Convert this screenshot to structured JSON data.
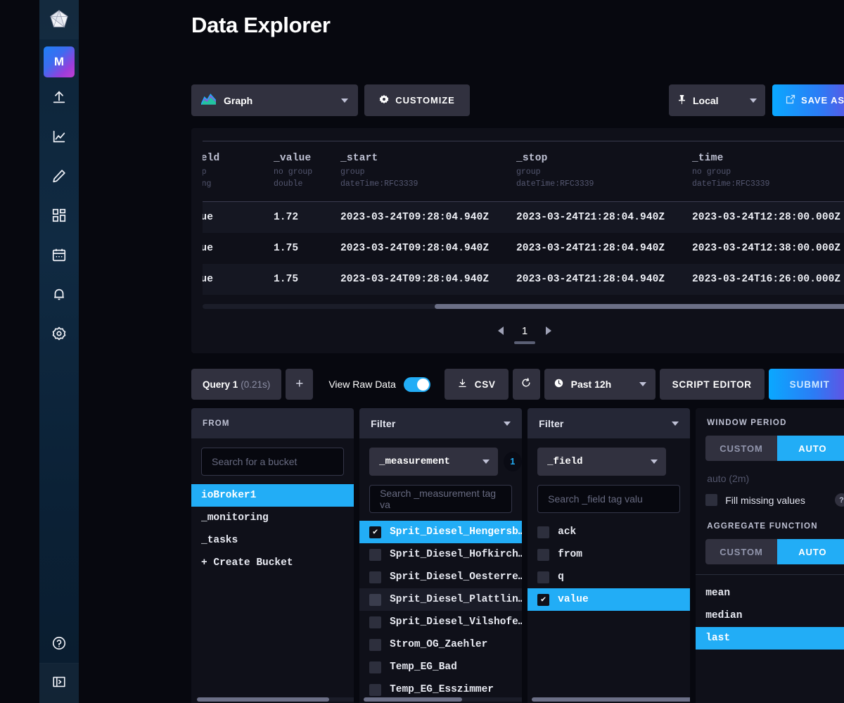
{
  "page": {
    "title": "Data Explorer"
  },
  "nav": {
    "logo": "influxdb-logo",
    "avatar_initial": "M",
    "items": [
      {
        "icon": "upload-icon",
        "name": "load-data"
      },
      {
        "icon": "line-chart-icon",
        "name": "explore"
      },
      {
        "icon": "pencil-icon",
        "name": "notebooks"
      },
      {
        "icon": "dashboard-grid-icon",
        "name": "dashboards"
      },
      {
        "icon": "calendar-icon",
        "name": "tasks"
      },
      {
        "icon": "bell-icon",
        "name": "alerts"
      },
      {
        "icon": "gear-icon",
        "name": "settings"
      }
    ],
    "help_icon": "question-circle-icon",
    "presentation_icon": "panel-expand-icon"
  },
  "toolbar": {
    "viz_type": "Graph",
    "viz_icon": "area-chart-icon",
    "customize_label": "CUSTOMIZE",
    "customize_icon": "gear-icon",
    "local_label": "Local",
    "local_icon": "pin-icon",
    "save_as_label": "SAVE AS",
    "save_as_icon": "external-link-icon"
  },
  "raw_table": {
    "columns": [
      {
        "name": "_field",
        "group": "group",
        "type": "string"
      },
      {
        "name": "_value",
        "group": "no group",
        "type": "double"
      },
      {
        "name": "_start",
        "group": "group",
        "type": "dateTime:RFC3339"
      },
      {
        "name": "_stop",
        "group": "group",
        "type": "dateTime:RFC3339"
      },
      {
        "name": "_time",
        "group": "no group",
        "type": "dateTime:RFC3339"
      }
    ],
    "rows": [
      [
        "value",
        "1.72",
        "2023-03-24T09:28:04.940Z",
        "2023-03-24T21:28:04.940Z",
        "2023-03-24T12:28:00.000Z"
      ],
      [
        "value",
        "1.75",
        "2023-03-24T09:28:04.940Z",
        "2023-03-24T21:28:04.940Z",
        "2023-03-24T12:38:00.000Z"
      ],
      [
        "value",
        "1.75",
        "2023-03-24T09:28:04.940Z",
        "2023-03-24T21:28:04.940Z",
        "2023-03-24T16:26:00.000Z"
      ]
    ],
    "pagination": {
      "page": "1",
      "prev_icon": "chevron-left-icon",
      "next_icon": "chevron-right-icon"
    }
  },
  "query_bar": {
    "query_label": "Query 1",
    "query_duration": "(0.21s)",
    "add_query_label": "+",
    "raw_data_label": "View Raw Data",
    "raw_data_on": true,
    "csv_label": "CSV",
    "csv_icon": "download-icon",
    "refresh_icon": "refresh-icon",
    "time_range": "Past 12h",
    "time_icon": "clock-icon",
    "script_editor_label": "SCRIPT EDITOR",
    "submit_label": "SUBMIT"
  },
  "from_panel": {
    "header": "FROM",
    "search_placeholder": "Search for a bucket",
    "buckets": [
      {
        "label": "ioBroker1",
        "selected": true
      },
      {
        "label": "_monitoring",
        "selected": false
      },
      {
        "label": "_tasks",
        "selected": false
      }
    ],
    "create_bucket_label": "+ Create Bucket"
  },
  "filter_measurement": {
    "header": "Filter",
    "tag_key": "_measurement",
    "count": "1",
    "search_placeholder": "Search _measurement tag va",
    "values": [
      {
        "label": "Sprit_Diesel_Hengersb…",
        "checked": true,
        "hover": false
      },
      {
        "label": "Sprit_Diesel_Hofkirch…",
        "checked": false,
        "hover": false
      },
      {
        "label": "Sprit_Diesel_Oesterre…",
        "checked": false,
        "hover": false
      },
      {
        "label": "Sprit_Diesel_Plattlin…",
        "checked": false,
        "hover": true
      },
      {
        "label": "Sprit_Diesel_Vilshofe…",
        "checked": false,
        "hover": false
      },
      {
        "label": "Strom_OG_Zaehler",
        "checked": false,
        "hover": false
      },
      {
        "label": "Temp_EG_Bad",
        "checked": false,
        "hover": false
      },
      {
        "label": "Temp_EG_Esszimmer",
        "checked": false,
        "hover": false
      }
    ]
  },
  "filter_field": {
    "header": "Filter",
    "tag_key": "_field",
    "search_placeholder": "Search _field tag valu",
    "values": [
      {
        "label": "ack",
        "checked": false
      },
      {
        "label": "from",
        "checked": false
      },
      {
        "label": "q",
        "checked": false
      },
      {
        "label": "value",
        "checked": true
      }
    ]
  },
  "right_panel": {
    "window_period_label": "WINDOW PERIOD",
    "window_custom": "CUSTOM",
    "window_auto": "AUTO",
    "window_auto_value": "auto (2m)",
    "fill_missing_label": "Fill missing values",
    "help_glyph": "?",
    "aggregate_label": "AGGREGATE FUNCTION",
    "agg_custom": "CUSTOM",
    "agg_auto": "AUTO",
    "functions": [
      {
        "label": "mean",
        "selected": false
      },
      {
        "label": "median",
        "selected": false
      },
      {
        "label": "last",
        "selected": true
      }
    ]
  },
  "colors": {
    "accent_blue": "#22adf6",
    "page_bg": "#07080f",
    "panel_bg": "#0f1019",
    "control_bg": "#31313f",
    "header_bg": "#252736"
  }
}
